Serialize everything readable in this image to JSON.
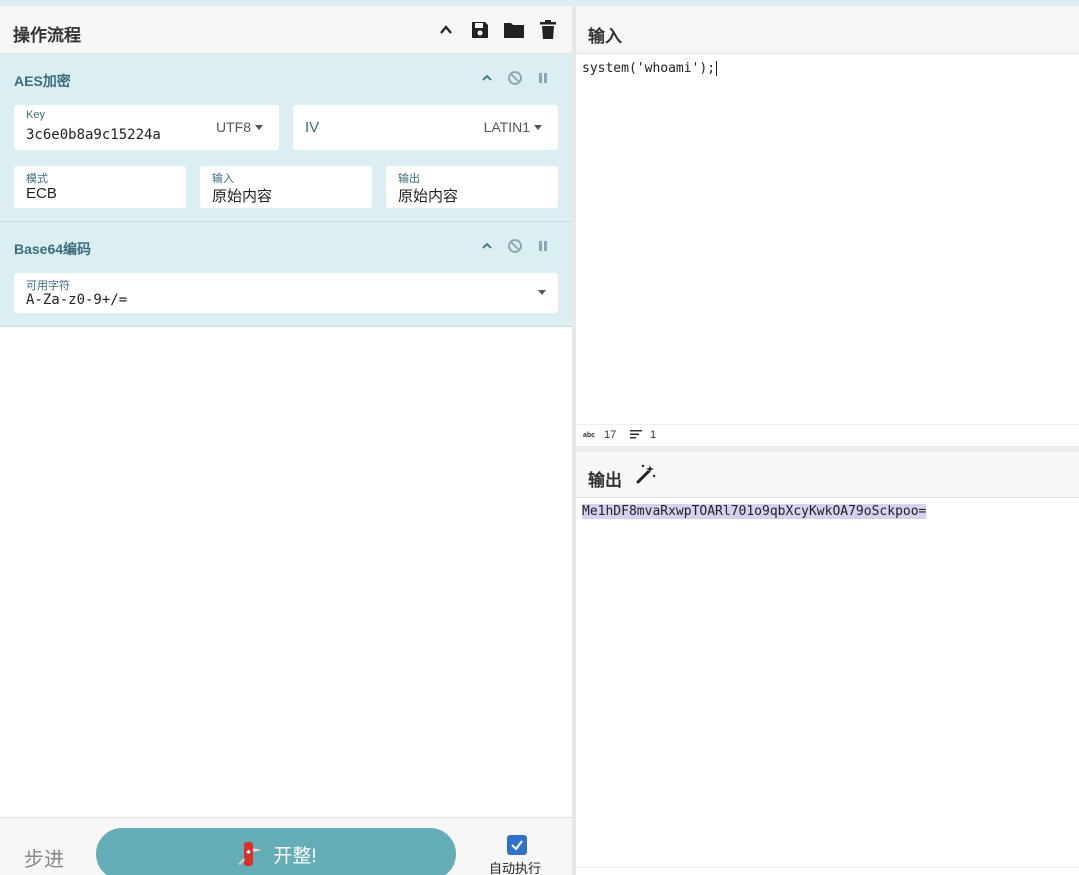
{
  "recipe": {
    "title": "操作流程",
    "operations": [
      {
        "name": "AES加密",
        "key_label": "Key",
        "key_value": "3c6e0b8a9c15224a",
        "key_encoding": "UTF8",
        "iv_label": "IV",
        "iv_value": "",
        "iv_encoding": "LATIN1",
        "mode_label": "模式",
        "mode_value": "ECB",
        "input_label": "输入",
        "input_value": "原始内容",
        "output_label": "输出",
        "output_value": "原始内容"
      },
      {
        "name": "Base64编码",
        "alphabet_label": "可用字符",
        "alphabet_value": "A-Za-z0-9+/="
      }
    ],
    "step_label": "步进",
    "bake_label": "开整!",
    "auto_bake_label": "自动执行",
    "auto_bake_checked": true
  },
  "input": {
    "title": "输入",
    "text": "system('whoami');",
    "stats": {
      "chars_icon": "abc",
      "chars": "17",
      "lines": "1"
    }
  },
  "output": {
    "title": "输出",
    "text": "Me1hDF8mvaRxwpTOARl701o9qbXcyKwkOA79oSckpoo="
  },
  "colors": {
    "accent": "#64adb6",
    "operation_bg": "#dbeef2",
    "operation_title": "#3a6d7c",
    "checkbox": "#2f73c8",
    "highlight": "#d7d1f0"
  }
}
